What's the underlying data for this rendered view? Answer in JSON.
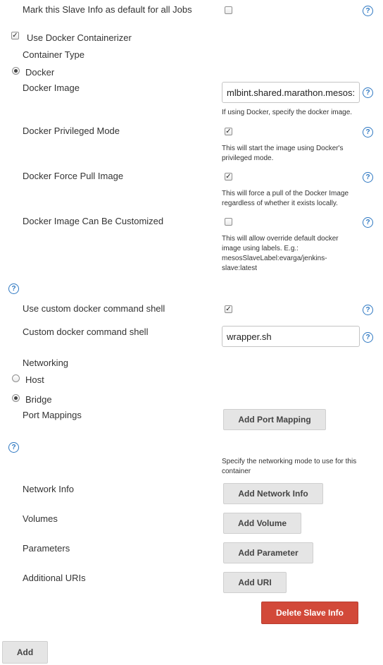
{
  "mark_default": {
    "label": "Mark this Slave Info as default for all Jobs",
    "checked": false
  },
  "docker": {
    "use_label": "Use Docker Containerizer",
    "use_checked": true,
    "container_type_label": "Container Type",
    "type_option": "Docker",
    "image_label": "Docker Image",
    "image_value": "mlbint.shared.marathon.mesos:",
    "image_help": "If using Docker, specify the docker image.",
    "privileged_label": "Docker Privileged Mode",
    "privileged_help": "This will start the image using Docker's privileged mode.",
    "force_pull_label": "Docker Force Pull Image",
    "force_pull_help": "This will force a pull of the Docker Image regardless of whether it exists locally.",
    "customized_label": "Docker Image Can Be Customized",
    "customized_help": "This will allow override default docker image using labels. E.g.: mesosSlaveLabel:evarga/jenkins-slave:latest",
    "custom_shell_use_label": "Use custom docker command shell",
    "custom_shell_label": "Custom docker command shell",
    "custom_shell_value": "wrapper.sh"
  },
  "networking": {
    "label": "Networking",
    "host_label": "Host",
    "bridge_label": "Bridge",
    "selected": "Bridge",
    "port_mappings_label": "Port Mappings",
    "add_port_mapping": "Add Port Mapping",
    "help": "Specify the networking mode to use for this container",
    "network_info_label": "Network Info",
    "add_network_info": "Add Network Info"
  },
  "volumes": {
    "label": "Volumes",
    "button": "Add Volume"
  },
  "parameters": {
    "label": "Parameters",
    "button": "Add Parameter"
  },
  "uris": {
    "label": "Additional URIs",
    "button": "Add URI"
  },
  "delete_button": "Delete Slave Info",
  "add_button": "Add",
  "colors": {
    "help_icon": "#2e78c2",
    "danger": "#d24939",
    "button_bg": "#e5e5e5"
  }
}
